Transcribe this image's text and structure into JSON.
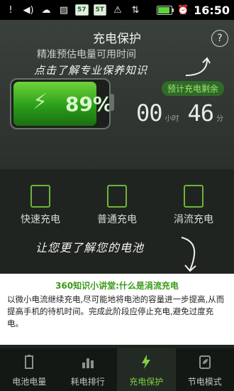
{
  "statusbar": {
    "badge1": "57",
    "badge2": "5T",
    "time": "16:50"
  },
  "header": {
    "title": "充电保护",
    "subtitle": "精准预估电量可用时间",
    "help": "?"
  },
  "hints": {
    "hint1": "点击了解专业保养知识",
    "hint2": "让您更了解您的电池"
  },
  "battery": {
    "percent_text": "89%",
    "level": 0.89,
    "remain_label": "预计充电剩余",
    "hours": "00",
    "hours_unit": "小时",
    "minutes": "46",
    "minutes_unit": "分"
  },
  "modes": [
    {
      "label": "快速充电"
    },
    {
      "label": "普通充电"
    },
    {
      "label": "涓流充电"
    }
  ],
  "info": {
    "title": "360知识小讲堂:什么是涓流充电",
    "text": "以微小电流继续充电,尽可能地将电池的容量进一步提高,从而提高手机的待机时间。完成此阶段应停止充电,避免过度充电。"
  },
  "nav": [
    {
      "label": "电池电量"
    },
    {
      "label": "耗电排行"
    },
    {
      "label": "充电保护"
    },
    {
      "label": "节电模式"
    }
  ],
  "colors": {
    "accent": "#7fcf45",
    "info_title": "#3a9a18"
  }
}
